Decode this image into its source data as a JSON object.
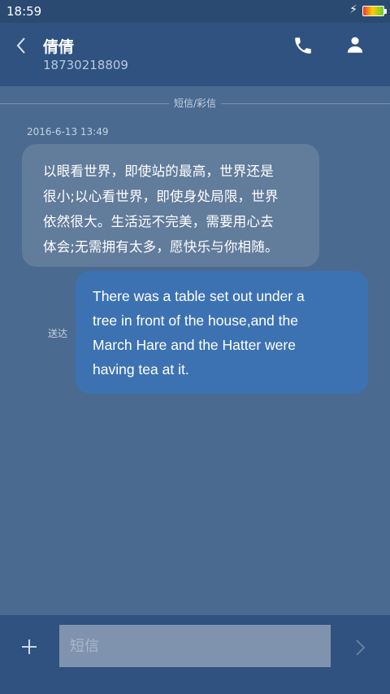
{
  "status_bar": {
    "time": "18:59",
    "charging_icon": "lightning-bolt-icon",
    "battery_icon": "battery-icon"
  },
  "header": {
    "back_icon": "chevron-left-icon",
    "contact_name": "倩倩",
    "contact_number": "18730218809",
    "call_icon": "phone-icon",
    "contact_icon": "person-icon"
  },
  "conversation": {
    "divider_label": "短信/彩信",
    "messages": [
      {
        "direction": "incoming",
        "timestamp": "2016-6-13 13:49",
        "lines": [
          "以眼看世界，即使站的最高，世界还是",
          "很小;以心看世界，即使身处局限，世界",
          "依然很大。生活远不完美，需要用心去",
          "体会;无需拥有太多，愿快乐与你相随。"
        ]
      },
      {
        "direction": "outgoing",
        "status": "送达",
        "lines": [
          "There was a table set out under a",
          "tree in front of the house,and the",
          "March Hare and the Hatter were",
          "having tea at it."
        ]
      }
    ]
  },
  "composer": {
    "add_icon": "plus-icon",
    "placeholder": "短信",
    "value": "",
    "send_icon": "chevron-right-icon"
  },
  "colors": {
    "background": "#4a6a90",
    "header": "#2f5280",
    "incoming_bubble": "#627c9b",
    "outgoing_bubble": "#3d72b2"
  }
}
